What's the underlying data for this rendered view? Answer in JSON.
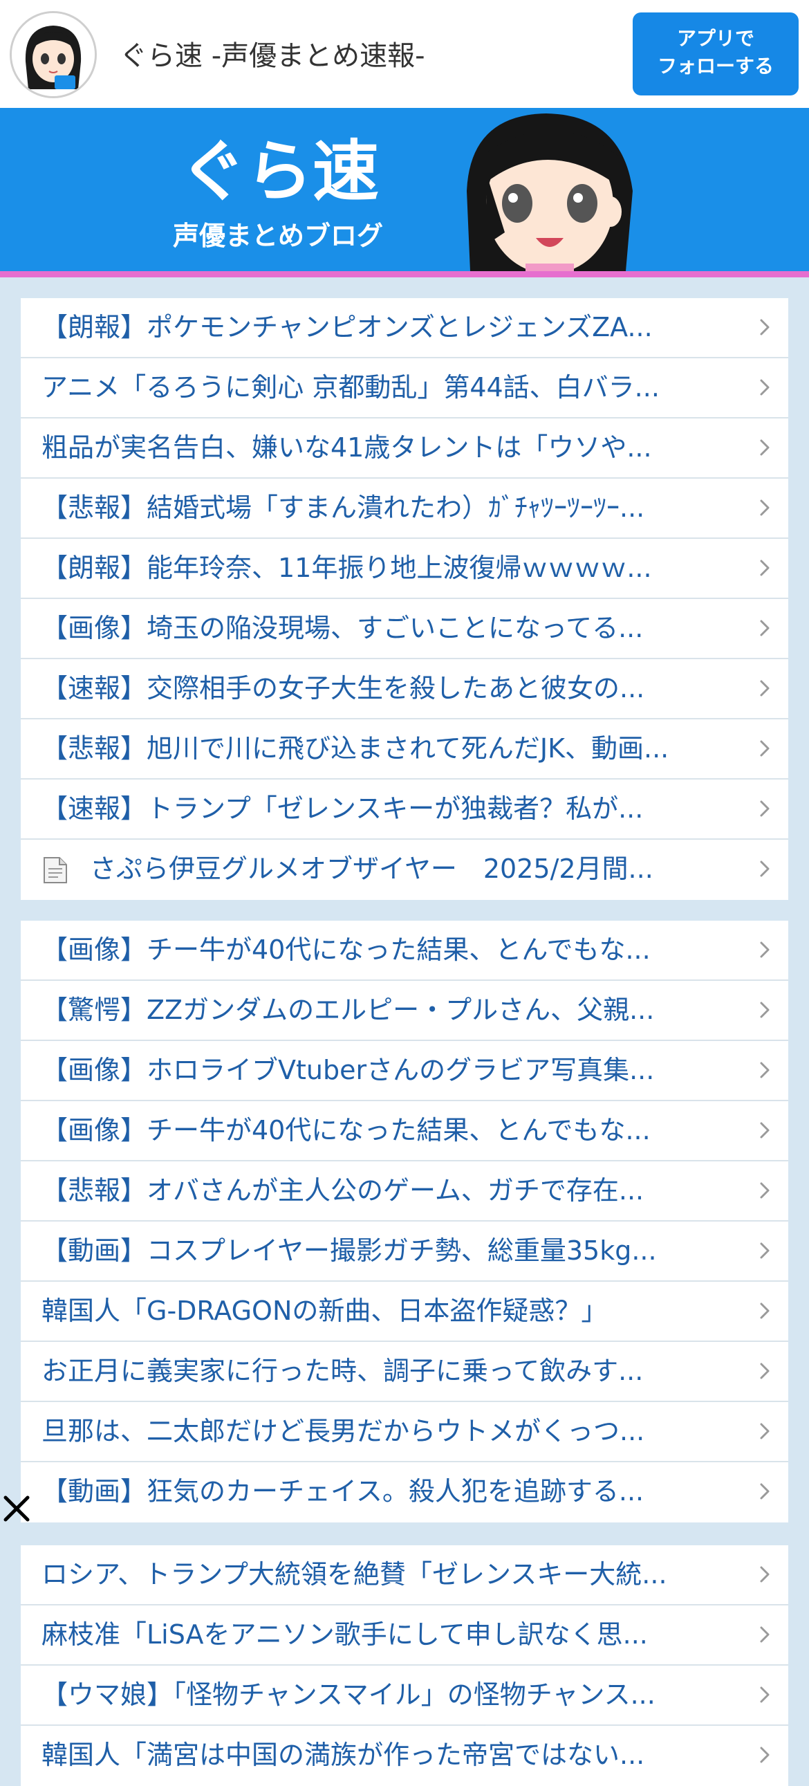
{
  "header": {
    "site_title": "ぐら速  -声優まとめ速報-",
    "follow_button": "アプリで\nフォローする",
    "follow_line1": "アプリで",
    "follow_line2": "フォローする"
  },
  "banner": {
    "logo_main": "ぐら速",
    "logo_sub": "声優まとめブログ"
  },
  "groups": [
    {
      "items": [
        {
          "title": "【朗報】ポケモンチャンピオンズとレジェンズZA..."
        },
        {
          "title": "アニメ「るろうに剣心 京都動乱」第44話、白バラ..."
        },
        {
          "title": "粗品が実名告白、嫌いな41歳タレントは「ウソや..."
        },
        {
          "title": "【悲報】結婚式場「すまん潰れたわ）ｶﾞﾁｬﾂｰﾂｰﾂｰ..."
        },
        {
          "title": "【朗報】能年玲奈、11年振り地上波復帰ｗｗｗｗ..."
        },
        {
          "title": "【画像】埼玉の陥没現場、すごいことになってる..."
        },
        {
          "title": "【速報】交際相手の女子大生を殺したあと彼女の..."
        },
        {
          "title": "【悲報】旭川で川に飛び込まされて死んだJK、動画..."
        },
        {
          "title": "【速報】トランプ「ゼレンスキーが独裁者？私が..."
        },
        {
          "title": "さぷら伊豆グルメオブザイヤー　2025/2月間...",
          "icon": "document-icon"
        }
      ]
    },
    {
      "items": [
        {
          "title": "【画像】チー牛が40代になった結果、とんでもな..."
        },
        {
          "title": "【驚愕】ZZガンダムのエルピー・プルさん、父親..."
        },
        {
          "title": "【画像】ホロライブVtuberさんのグラビア写真集..."
        },
        {
          "title": "【画像】チー牛が40代になった結果、とんでもな..."
        },
        {
          "title": "【悲報】オバさんが主人公のゲーム、ガチで存在..."
        },
        {
          "title": "【動画】コスプレイヤー撮影ガチ勢、総重量35kg..."
        },
        {
          "title": "韓国人「G-DRAGONの新曲、日本盗作疑惑？」"
        },
        {
          "title": "お正月に義実家に行った時、調子に乗って飲みす..."
        },
        {
          "title": "旦那は、二太郎だけど長男だからウトメがくっつ..."
        },
        {
          "title": "【動画】狂気のカーチェイス。殺人犯を追跡する..."
        }
      ]
    },
    {
      "items": [
        {
          "title": "ロシア、トランプ大統領を絶賛「ゼレンスキー大統..."
        },
        {
          "title": "麻枝准「LiSAをアニソン歌手にして申し訳なく思..."
        },
        {
          "title": "【ウマ娘】「怪物チャンスマイル」の怪物チャンス..."
        },
        {
          "title": "韓国人「満宮は中国の満族が作った帝宮ではない..."
        }
      ]
    }
  ],
  "colors": {
    "accent": "#1688e6",
    "link": "#1f5fa8",
    "banner": "#1a8fe8",
    "pink_rule": "#e66fcf",
    "page_bg": "#d6e6f2"
  }
}
